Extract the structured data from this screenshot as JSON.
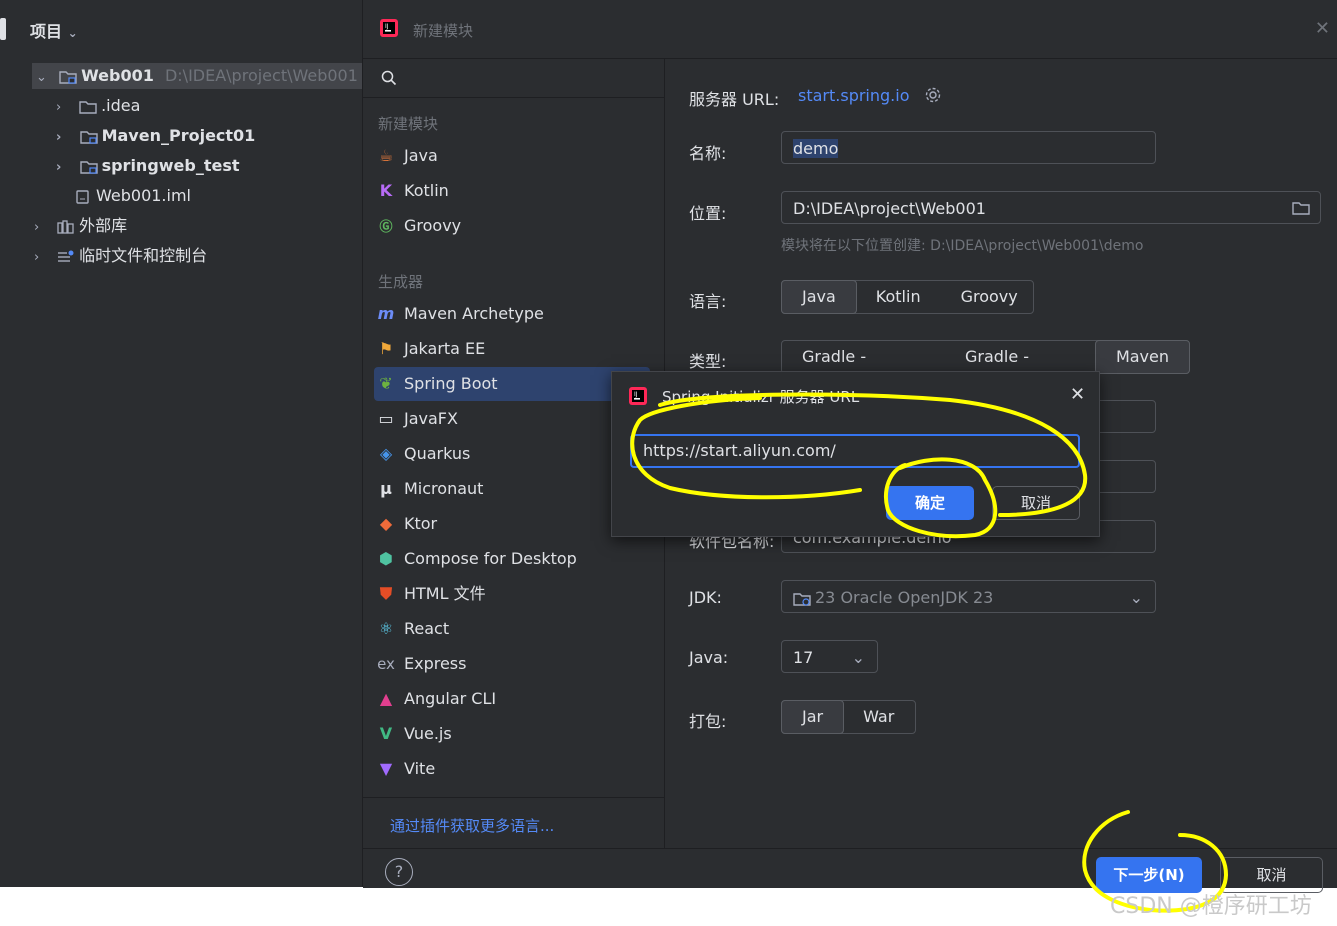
{
  "project_panel": {
    "title": "项目",
    "tree": [
      {
        "label": "Web001",
        "path": "D:\\IDEA\\project\\Web001"
      },
      {
        "label": ".idea"
      },
      {
        "label": "Maven_Project01"
      },
      {
        "label": "springweb_test"
      },
      {
        "label": "Web001.iml"
      },
      {
        "label": "外部库"
      },
      {
        "label": "临时文件和控制台"
      }
    ]
  },
  "dialog": {
    "title": "新建模块",
    "sections": {
      "new_module": "新建模块",
      "generators": "生成器"
    },
    "new_module_items": [
      {
        "label": "Java",
        "icon": "java-cup-icon"
      },
      {
        "label": "Kotlin",
        "icon": "kotlin-icon"
      },
      {
        "label": "Groovy",
        "icon": "groovy-icon"
      }
    ],
    "generator_items": [
      {
        "label": "Maven Archetype",
        "icon": "maven-icon"
      },
      {
        "label": "Jakarta EE",
        "icon": "jakarta-icon"
      },
      {
        "label": "Spring Boot",
        "icon": "spring-icon"
      },
      {
        "label": "JavaFX",
        "icon": "javafx-icon"
      },
      {
        "label": "Quarkus",
        "icon": "quarkus-icon"
      },
      {
        "label": "Micronaut",
        "icon": "micronaut-icon"
      },
      {
        "label": "Ktor",
        "icon": "ktor-icon"
      },
      {
        "label": "Compose for Desktop",
        "icon": "compose-icon"
      },
      {
        "label": "HTML 文件",
        "icon": "html5-icon"
      },
      {
        "label": "React",
        "icon": "react-icon"
      },
      {
        "label": "Express",
        "icon": "express-icon"
      },
      {
        "label": "Angular CLI",
        "icon": "angular-icon"
      },
      {
        "label": "Vue.js",
        "icon": "vue-icon"
      },
      {
        "label": "Vite",
        "icon": "vite-icon"
      }
    ],
    "plugin_link": "通过插件获取更多语言...",
    "form": {
      "server_url_label": "服务器 URL:",
      "server_url": "start.spring.io",
      "name_label": "名称:",
      "name_value": "demo",
      "location_label": "位置:",
      "location_value": "D:\\IDEA\\project\\Web001",
      "location_hint": "模块将在以下位置创建: D:\\IDEA\\project\\Web001\\demo",
      "language_label": "语言:",
      "languages": [
        "Java",
        "Kotlin",
        "Groovy"
      ],
      "type_label": "类型:",
      "types": [
        "Gradle - Groovy",
        "Gradle - Kotlin",
        "Maven"
      ],
      "package_label": "软件包名称:",
      "package_value": "com.example.demo",
      "jdk_label": "JDK:",
      "jdk_value": "23 Oracle OpenJDK 23",
      "java_label": "Java:",
      "java_value": "17",
      "packaging_label": "打包:",
      "packaging": [
        "Jar",
        "War"
      ]
    },
    "buttons": {
      "help": "?",
      "next": "下一步(N)",
      "cancel": "取消"
    }
  },
  "popup": {
    "title": "Spring Initializr 服务器 URL",
    "url_value": "https://start.aliyun.com/",
    "ok": "确定",
    "cancel": "取消"
  },
  "watermark": "CSDN @橙序研工坊",
  "colors": {
    "accent": "#3574f0",
    "selection": "#2e436e",
    "annotation": "#ffff00"
  }
}
